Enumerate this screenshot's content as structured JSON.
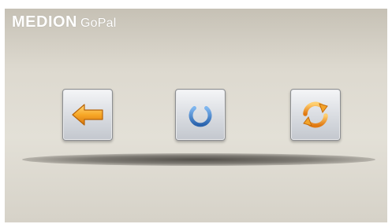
{
  "brand": {
    "main": "MEDION",
    "sub": "GoPal"
  },
  "toolbar": {
    "buttons": [
      {
        "icon": "arrow-left-icon"
      },
      {
        "icon": "power-icon"
      },
      {
        "icon": "refresh-icon"
      }
    ]
  },
  "colors": {
    "background": "#ddd9cf",
    "brand_text": "#ffffff",
    "arrow_orange": "#f29b16",
    "power_blue": "#3c7fc8",
    "refresh_orange": "#f0921b"
  }
}
